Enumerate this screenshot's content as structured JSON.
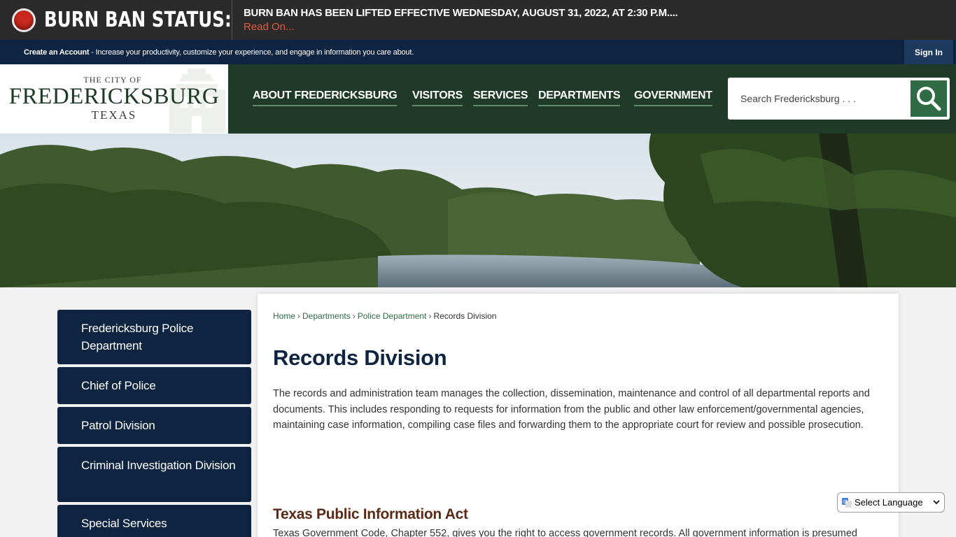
{
  "alert": {
    "title": "BURN BAN STATUS:",
    "message": "BURN BAN HAS BEEN LIFTED EFFECTIVE WEDNESDAY, AUGUST 31, 2022, AT 2:30 P.M....",
    "link": "Read On..."
  },
  "account_bar": {
    "create_link": "Create an Account",
    "text": " - Increase your productivity, customize your experience, and engage in information you care about.",
    "signin": "Sign In"
  },
  "logo": {
    "small": "THE CITY OF",
    "main": "FREDERICKSBURG",
    "sub": "TEXAS"
  },
  "nav": {
    "items": [
      "ABOUT FREDERICKSBURG",
      "VISITORS",
      "SERVICES",
      "DEPARTMENTS",
      "GOVERNMENT"
    ]
  },
  "search": {
    "placeholder": "Search Fredericksburg . . ."
  },
  "sidebar": {
    "items": [
      "Fredericksburg Police Department",
      "Chief of Police",
      "Patrol Division",
      "Criminal Investigation Division",
      "Special Services"
    ]
  },
  "breadcrumb": {
    "home": "Home",
    "departments": "Departments",
    "police": "Police Department",
    "current": "Records Division",
    "sep": "›"
  },
  "content": {
    "title": "Records Division",
    "intro": "The records and administration team manages the collection, dissemination, maintenance and control of all departmental reports and documents. This includes responding to requests for information from the public and other law enforcement/governmental agencies, maintaining case information, compiling case files and forwarding them to the appropriate court for review and possible prosecution.",
    "subtitle": "Texas Public Information Act",
    "subtext": "Texas Government Code, Chapter 552, gives you the right to access government records. All government information is presumed"
  },
  "translate": {
    "label": "Select Language"
  },
  "colors": {
    "alert_bg": "#2b2b2b",
    "navy": "#0e2440",
    "header_green": "#203a29",
    "accent_green": "#2f6c45",
    "alert_red": "#c8281e"
  }
}
